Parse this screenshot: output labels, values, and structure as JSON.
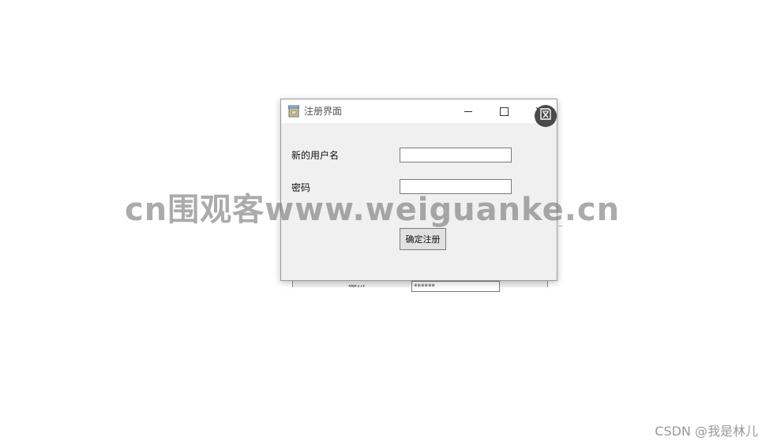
{
  "background_window": {
    "label": "密码",
    "input_value": "******"
  },
  "dialog": {
    "title": "注册界面",
    "icons": {
      "app": "app-window-icon",
      "minimize": "minimize-icon",
      "maximize": "maximize-icon",
      "close": "close-icon"
    },
    "close_glyph": "✕",
    "username_label": "新的用户名",
    "username_value": "",
    "password_label": "密码",
    "password_value": "",
    "submit_label": "确定注册"
  },
  "overlay": {
    "translate_icon": "translate-icon",
    "watermark": "cn围观客www.weiguanke.cn",
    "credit": "CSDN @我是林儿"
  },
  "colors": {
    "dialog_bg": "#f0f0f0",
    "titlebar_bg": "#ffffff",
    "button_bg": "#e1e1e1",
    "badge_bg": "#4a4a4a"
  }
}
